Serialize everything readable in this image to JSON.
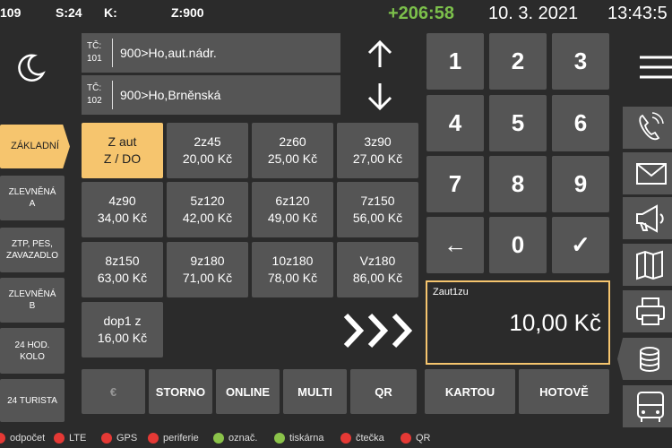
{
  "header": {
    "counter": "109",
    "s": "S:24",
    "k": "K:",
    "z": "Z:900",
    "delay": "+206:58",
    "date": "10. 3. 2021",
    "time": "13:43:5"
  },
  "stops": [
    {
      "tc_label": "TČ:",
      "tc_num": "101",
      "name": "900>Ho,aut.nádr."
    },
    {
      "tc_label": "TČ:",
      "tc_num": "102",
      "name": "900>Ho,Brněnská"
    }
  ],
  "left_tabs": [
    {
      "l1": "ZÁKLADNÍ",
      "l2": ""
    },
    {
      "l1": "ZLEVNĚNÁ",
      "l2": "A"
    },
    {
      "l1": "ZTP, PES,",
      "l2": "ZAVAZADLO"
    },
    {
      "l1": "ZLEVNĚNÁ",
      "l2": "B"
    },
    {
      "l1": "24 HOD.",
      "l2": "KOLO"
    },
    {
      "l1": "24 TURISTA",
      "l2": ""
    }
  ],
  "tariffs": [
    {
      "name": "Z aut",
      "price": "Z / DO"
    },
    {
      "name": "2z45",
      "price": "20,00 Kč"
    },
    {
      "name": "2z60",
      "price": "25,00 Kč"
    },
    {
      "name": "3z90",
      "price": "27,00 Kč"
    },
    {
      "name": "4z90",
      "price": "34,00 Kč"
    },
    {
      "name": "5z120",
      "price": "42,00 Kč"
    },
    {
      "name": "6z120",
      "price": "49,00 Kč"
    },
    {
      "name": "7z150",
      "price": "56,00 Kč"
    },
    {
      "name": "8z150",
      "price": "63,00 Kč"
    },
    {
      "name": "9z180",
      "price": "71,00 Kč"
    },
    {
      "name": "10z180",
      "price": "78,00 Kč"
    },
    {
      "name": "Vz180",
      "price": "86,00 Kč"
    },
    {
      "name": "dop1 z",
      "price": "16,00 Kč"
    }
  ],
  "keypad": [
    "1",
    "2",
    "3",
    "4",
    "5",
    "6",
    "7",
    "8",
    "9",
    "←",
    "0",
    "✓"
  ],
  "display": {
    "label": "Zaut1zu",
    "amount": "10,00 Kč"
  },
  "buttons": {
    "euro": "€",
    "storno": "STORNO",
    "online": "ONLINE",
    "multi": "MULTI",
    "qr": "QR",
    "card": "KARTOU",
    "cash": "HOTOVĚ"
  },
  "status": [
    {
      "label": "odpočet",
      "color": "#e53935"
    },
    {
      "label": "LTE",
      "color": "#e53935"
    },
    {
      "label": "GPS",
      "color": "#e53935"
    },
    {
      "label": "periferie",
      "color": "#e53935"
    },
    {
      "label": "označ.",
      "color": "#8bc34a"
    },
    {
      "label": "tiskárna",
      "color": "#8bc34a"
    },
    {
      "label": "čtečka",
      "color": "#e53935"
    },
    {
      "label": "QR",
      "color": "#e53935"
    }
  ],
  "colors": {
    "accent": "#f6c56e",
    "delay": "#7cc04b"
  },
  "icons": [
    "moon-icon",
    "arrow-up-icon",
    "arrow-down-icon",
    "menu-icon",
    "phone-icon",
    "mail-icon",
    "megaphone-icon",
    "map-icon",
    "printer-icon",
    "coins-icon",
    "bus-icon",
    "chevrons-right-icon"
  ]
}
